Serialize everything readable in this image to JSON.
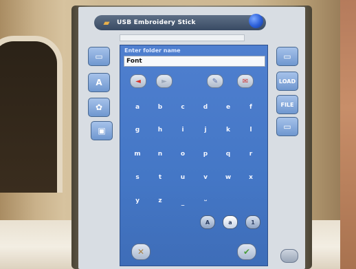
{
  "titlebar": {
    "title": "USB Embroidery Stick",
    "icon": "usb-stick-icon"
  },
  "panel": {
    "prompt": "Enter folder name",
    "input_value": "Font"
  },
  "controls": {
    "left_arrow": "◄",
    "right_arrow": "►",
    "erase_icon": "✎",
    "save_icon": "✉"
  },
  "keyboard": {
    "rows": [
      [
        "a",
        "b",
        "c",
        "d",
        "e",
        "f"
      ],
      [
        "g",
        "h",
        "i",
        "j",
        "k",
        "l"
      ],
      [
        "m",
        "n",
        "o",
        "p",
        "q",
        "r"
      ],
      [
        "s",
        "t",
        "u",
        "v",
        "w",
        "x"
      ],
      [
        "y",
        "z",
        "_",
        "˽"
      ]
    ],
    "modes": [
      "A",
      "a",
      "1"
    ]
  },
  "side_left": [
    {
      "name": "folder-button",
      "glyph": "▭"
    },
    {
      "name": "font-button",
      "glyph": "A"
    },
    {
      "name": "embroidery-button",
      "glyph": "✿"
    },
    {
      "name": "machine-button",
      "glyph": "▣"
    }
  ],
  "side_right": [
    {
      "name": "open-folder-button",
      "glyph": "▭"
    },
    {
      "name": "load-button",
      "glyph": "LOAD"
    },
    {
      "name": "file-name-button",
      "glyph": "FILE"
    },
    {
      "name": "new-folder-button",
      "glyph": "▭"
    }
  ],
  "actions": {
    "cancel": "✕",
    "ok": "✔"
  },
  "colors": {
    "panel": "#4477c6",
    "titlebar": "#384a63",
    "accent_red": "#d6342c"
  }
}
